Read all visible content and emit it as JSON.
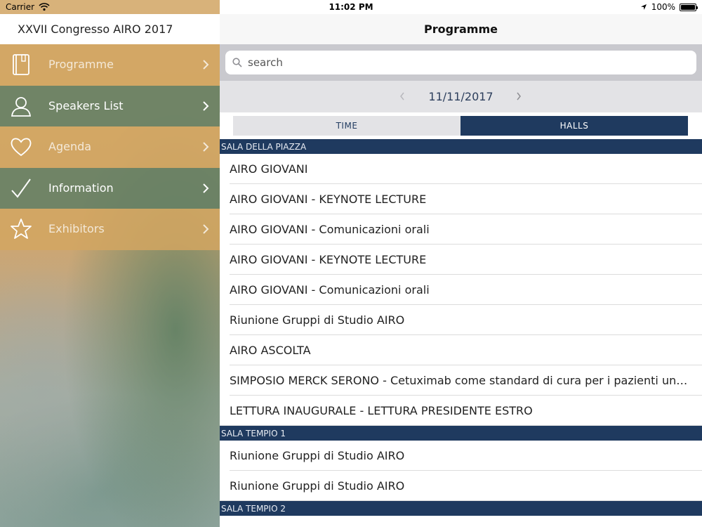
{
  "status_bar": {
    "carrier": "Carrier",
    "time": "11:02 PM",
    "battery": "100%"
  },
  "sidebar": {
    "title": "XXVII Congresso AIRO 2017",
    "items": [
      {
        "label": "Programme",
        "icon": "book-icon"
      },
      {
        "label": "Speakers List",
        "icon": "person-icon"
      },
      {
        "label": "Agenda",
        "icon": "heart-icon"
      },
      {
        "label": "Information",
        "icon": "checkmark-icon"
      },
      {
        "label": "Exhibitors",
        "icon": "star-icon"
      }
    ]
  },
  "main": {
    "title": "Programme",
    "search": {
      "placeholder": "search"
    },
    "date": "11/11/2017",
    "segments": {
      "time": "TIME",
      "halls": "HALLS",
      "selected": "HALLS"
    },
    "sections": [
      {
        "header": "SALA DELLA PIAZZA",
        "rows": [
          "AIRO GIOVANI",
          "AIRO GIOVANI - KEYNOTE LECTURE",
          "AIRO GIOVANI - Comunicazioni orali",
          "AIRO GIOVANI - KEYNOTE LECTURE",
          "AIRO GIOVANI - Comunicazioni orali",
          "Riunione Gruppi di Studio AIRO",
          "AIRO ASCOLTA",
          "SIMPOSIO MERCK SERONO - Cetuximab come standard di cura per i pazienti unfit...",
          "LETTURA INAUGURALE - LETTURA PRESIDENTE ESTRO"
        ]
      },
      {
        "header": "SALA TEMPIO 1",
        "rows": [
          "Riunione Gruppi di Studio AIRO",
          "Riunione Gruppi di Studio AIRO"
        ]
      },
      {
        "header": "SALA TEMPIO 2",
        "rows": []
      }
    ]
  },
  "colors": {
    "navy": "#1f3a5f",
    "sidebar_tan": "#d2a662",
    "sidebar_green": "#627e64"
  }
}
